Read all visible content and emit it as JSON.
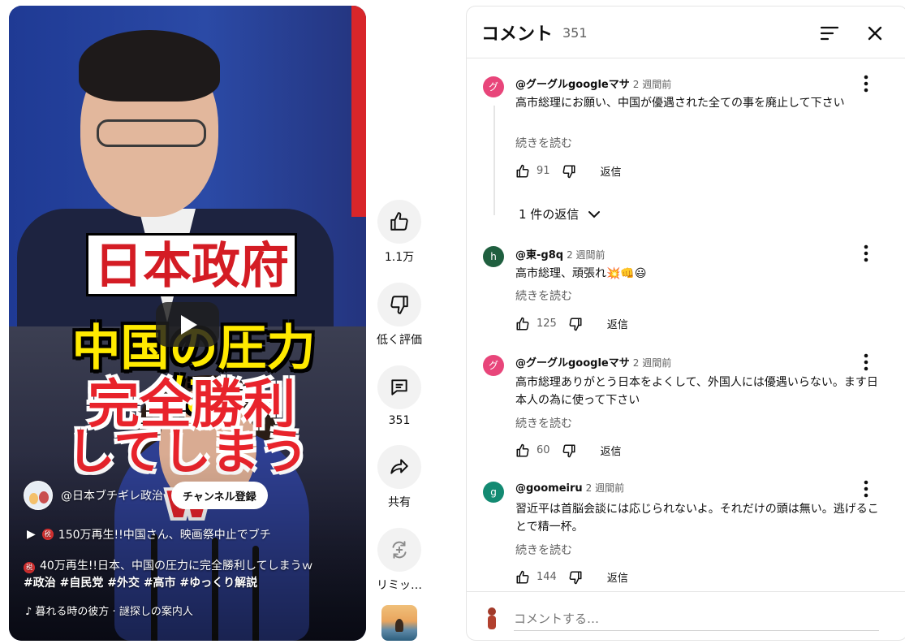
{
  "video": {
    "banner_line1": "日本政府",
    "banner_line2": "中国の圧力に",
    "banner_line3": "完全勝利",
    "banner_line4": "してしまうw",
    "channel_name": "@日本ブチギレ政治",
    "subscribe_label": "チャンネル登録",
    "playlist_title": "150万再生!!中国さん、映画祭中止でブチ",
    "badge_glyph": "税",
    "title": "40万再生!!日本、中国の圧力に完全勝利してしまうｗ",
    "hashtags": "#政治 #自民党 #外交 #高市 #ゆっくり解説",
    "music": "♪ 暮れる時の彼方 · 謎探しの案内人",
    "play_icon": "play-icon"
  },
  "actions": {
    "like_count": "1.1万",
    "dislike_label": "低く評価",
    "comments_count": "351",
    "share_label": "共有",
    "remix_label": "リミッ…"
  },
  "comments_panel": {
    "title": "コメント",
    "count": "351",
    "input_placeholder": "コメントする…",
    "comments": [
      {
        "avatar_letter": "グ",
        "avatar_color": "#e8457a",
        "author": "@グーグルgoogleマサ",
        "time": "2 週間前",
        "text": "高市総理にお願い、中国が優遇された全ての事を廃止して下さい",
        "read_more": "続きを読む",
        "likes": "91",
        "reply_label": "返信",
        "replies_label": "1 件の返信"
      },
      {
        "avatar_letter": "h",
        "avatar_color": "#1f5f3f",
        "author": "@東-g8q",
        "time": "2 週間前",
        "text": "高市総理、頑張れ💥👊😃",
        "read_more": "続きを読む",
        "likes": "125",
        "reply_label": "返信"
      },
      {
        "avatar_letter": "グ",
        "avatar_color": "#e8457a",
        "author": "@グーグルgoogleマサ",
        "time": "2 週間前",
        "text": "高市総理ありがとう日本をよくして、外国人には優遇いらない。ます日本人の為に使って下さい",
        "read_more": "続きを読む",
        "likes": "60",
        "reply_label": "返信"
      },
      {
        "avatar_letter": "g",
        "avatar_color": "#138a72",
        "author": "@goomeiru",
        "time": "2 週間前",
        "text": "習近平は首脳会談には応じられないよ。それだけの頭は無い。逃げることで精一杯。",
        "read_more": "続きを読む",
        "likes": "144",
        "reply_label": "返信"
      }
    ]
  }
}
